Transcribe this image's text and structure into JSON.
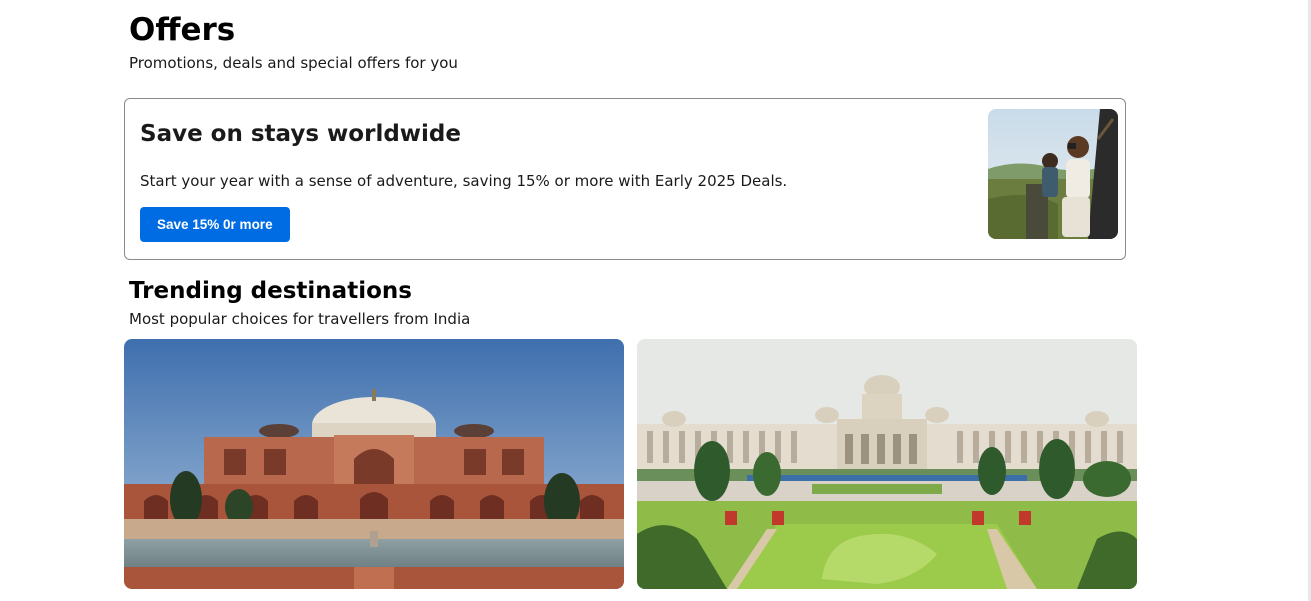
{
  "offers": {
    "title": "Offers",
    "subtitle": "Promotions, deals and special offers for you",
    "card": {
      "title": "Save on stays worldwide",
      "description": "Start your year with a sense of adventure, saving 15% or more with Early 2025 Deals.",
      "button_label": "Save 15% 0r more",
      "image_icon": "travel-photo"
    }
  },
  "trending": {
    "title": "Trending destinations",
    "subtitle": "Most popular choices for travellers from India",
    "destinations": [
      {
        "image_icon": "humayuns-tomb-photo"
      },
      {
        "image_icon": "vidhana-soudha-photo"
      }
    ]
  },
  "colors": {
    "accent": "#006ce4",
    "text": "#1a1a1a",
    "card_border": "#8a8a8a"
  }
}
